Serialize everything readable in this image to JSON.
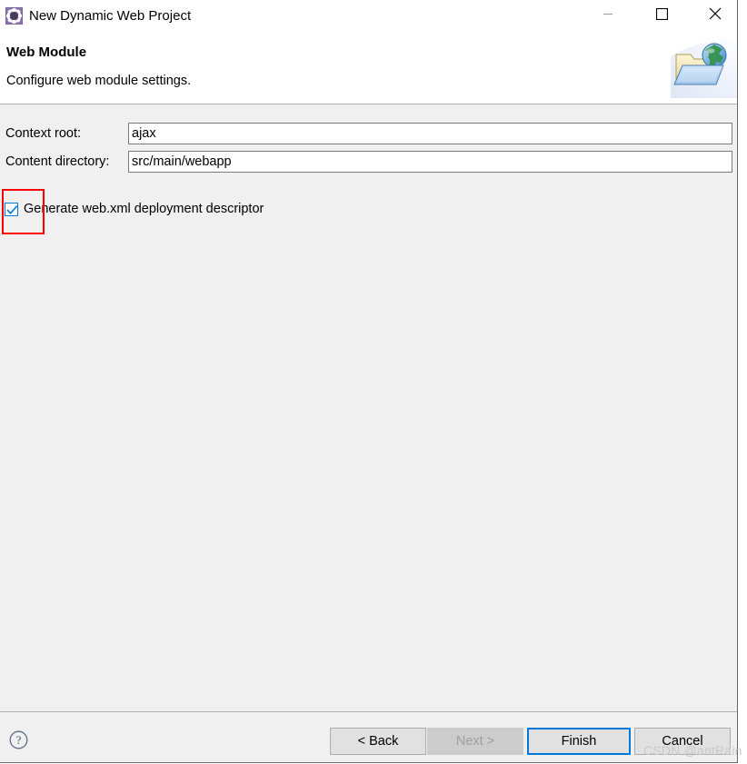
{
  "window": {
    "title": "New Dynamic Web Project",
    "icon": "eclipse-project-gear-icon",
    "controls": {
      "minimize": "minimize-icon",
      "maximize": "maximize-icon",
      "close": "close-icon"
    }
  },
  "header": {
    "title": "Web Module",
    "description": "Configure web module settings.",
    "graphic": "web-folder-globe-icon"
  },
  "form": {
    "context_root": {
      "label": "Context root:",
      "value": "ajax",
      "placeholder": ""
    },
    "content_directory": {
      "label": "Content directory:",
      "value": "src/main/webapp",
      "placeholder": ""
    },
    "generate_webxml": {
      "label": "Generate web.xml deployment descriptor",
      "checked": true
    }
  },
  "annotation": {
    "color": "#ff0000",
    "target": "generate-webxml-checkbox"
  },
  "footer": {
    "help": "help-icon",
    "buttons": {
      "back": "< Back",
      "next": "Next >",
      "finish": "Finish",
      "cancel": "Cancel"
    },
    "next_enabled": false,
    "default_button": "Finish"
  },
  "watermark": {
    "text": "CSDN @antRain"
  },
  "colors": {
    "accent": "#0078d7",
    "annotation": "#ff0000",
    "dialog_background": "#f0f0f0",
    "header_background": "#ffffff"
  }
}
